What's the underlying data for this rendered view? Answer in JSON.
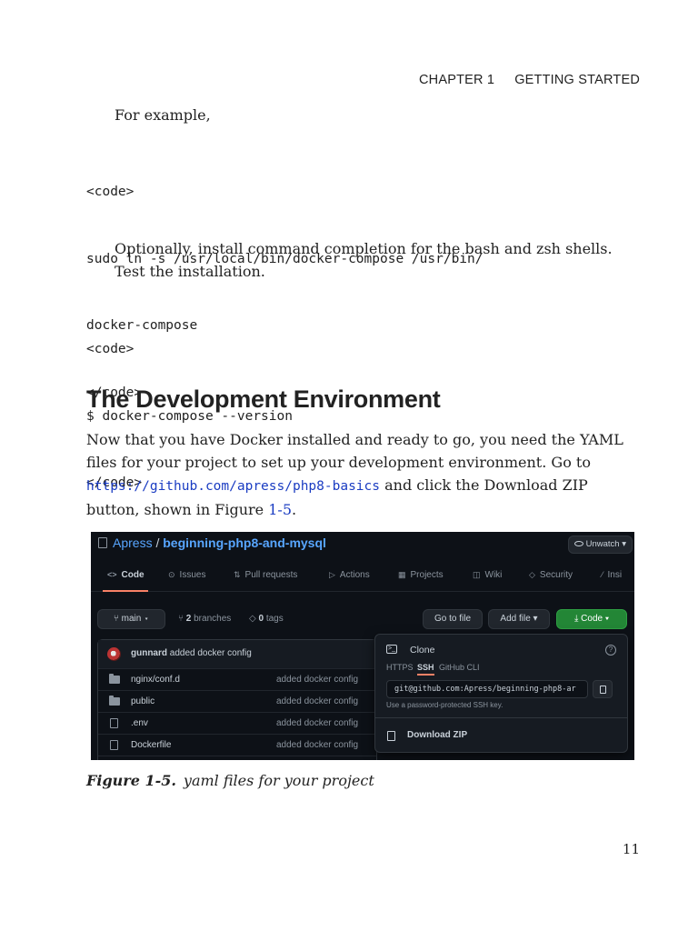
{
  "running_head": {
    "chapter": "CHAPTER 1",
    "title": "GETTING STARTED"
  },
  "intro": "For example,",
  "code_block_1": [
    "<code>",
    "sudo ln -s /usr/local/bin/docker-compose /usr/bin/",
    "docker-compose",
    "</code>"
  ],
  "optional_para": {
    "line1": "Optionally, install command completion for the bash and zsh shells.",
    "line2": "Test the installation."
  },
  "code_block_2": [
    "<code>",
    "$ docker-compose --version",
    "</code>"
  ],
  "section_heading": "The Development Environment",
  "body_para": {
    "line1": "Now that you have Docker installed and ready to go, you need the YAML",
    "line2": "files for your project to set up your development environment. Go to",
    "link": "https://github.com/apress/php8-basics",
    "line3_after_link": " and click the Download ZIP",
    "line4_before_ref": "button, shown in Figure ",
    "figure_ref": "1-5",
    "line4_after_ref": "."
  },
  "screenshot": {
    "owner": "Apress",
    "separator": " / ",
    "repo": "beginning-php8-and-mysql",
    "unwatch": "Unwatch",
    "tabs": [
      "Code",
      "Issues",
      "Pull requests",
      "Actions",
      "Projects",
      "Wiki",
      "Security",
      "Insi"
    ],
    "tab_icons": [
      "<>",
      "⊙",
      "⇅",
      "▷",
      "▦",
      "◫",
      "◇",
      "⁄"
    ],
    "branch": "main",
    "branches_count": "2",
    "branches_label": "branches",
    "tags_count": "0",
    "tags_label": "tags",
    "go_to_file": "Go to file",
    "add_file": "Add file",
    "code_button": "Code",
    "commit_author": "gunnard",
    "commit_message": "added docker config",
    "files": [
      {
        "name": "nginx/conf.d",
        "message": "added docker config",
        "type": "folder"
      },
      {
        "name": "public",
        "message": "added docker config",
        "type": "folder"
      },
      {
        "name": ".env",
        "message": "added docker config",
        "type": "file"
      },
      {
        "name": "Dockerfile",
        "message": "added docker config",
        "type": "file"
      }
    ],
    "clone": {
      "title": "Clone",
      "protocols": [
        "HTTPS",
        "SSH",
        "GitHub CLI"
      ],
      "active_protocol": "SSH",
      "url": "git@github.com:Apress/beginning-php8-ar",
      "hint": "Use a password-protected SSH key.",
      "download_zip": "Download ZIP"
    },
    "accent_colors": {
      "link": "#58a6ff",
      "green": "#238636",
      "tab_underline": "#f78166",
      "background": "#0d1117"
    }
  },
  "caption": {
    "label": "Figure 1-5.",
    "text": "yaml files for your project"
  },
  "page_number": "11"
}
